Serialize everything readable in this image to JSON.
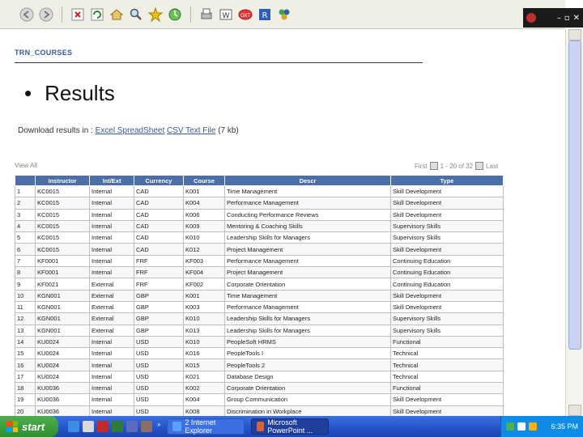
{
  "browser": {
    "window_controls": {
      "minimize": "–",
      "maximize": "▫",
      "close": "✕"
    },
    "toolbar_icons": [
      "back-icon",
      "forward-icon",
      "stop-icon",
      "refresh-icon",
      "home-icon",
      "search-icon",
      "favorites-icon",
      "history-icon",
      "print-icon",
      "edit-icon",
      "messenger-icon",
      "research-icon",
      "extensions-icon"
    ]
  },
  "page": {
    "heading": "TRN_COURSES",
    "bullet_title": "Results",
    "download_prefix": "Download results in :",
    "download_excel": "Excel SpreadSheet",
    "download_csv": "CSV Text File",
    "download_size": "(7 kb)",
    "view_all": "View All",
    "pager_first": "First",
    "pager_range": "1 - 20 of 32",
    "pager_last": "Last"
  },
  "table": {
    "headers": [
      "",
      "Instructor",
      "Int/Ext",
      "Currency",
      "Course",
      "Descr",
      "Type"
    ],
    "rows": [
      [
        "1",
        "KC0015",
        "Internal",
        "CAD",
        "K001",
        "Time Management",
        "Skill Development"
      ],
      [
        "2",
        "KC0015",
        "Internal",
        "CAD",
        "K004",
        "Performance Management",
        "Skill Development"
      ],
      [
        "3",
        "KC0015",
        "Internal",
        "CAD",
        "K006",
        "Conducting Performance Reviews",
        "Skill Development"
      ],
      [
        "4",
        "KC0015",
        "Internal",
        "CAD",
        "K009",
        "Mentoring & Coaching Skills",
        "Supervisory Skills"
      ],
      [
        "5",
        "KC0015",
        "Internal",
        "CAD",
        "K010",
        "Leadership Skills for Managers",
        "Supervisory Skills"
      ],
      [
        "6",
        "KC0015",
        "Internal",
        "CAD",
        "K012",
        "Project Management",
        "Skill Development"
      ],
      [
        "7",
        "KF0001",
        "Internal",
        "FRF",
        "KF003",
        "Performance Management",
        "Continuing Education"
      ],
      [
        "8",
        "KF0001",
        "Internal",
        "FRF",
        "KF004",
        "Project Management",
        "Continuing Education"
      ],
      [
        "9",
        "KF0021",
        "External",
        "FRF",
        "KF002",
        "Corporate Orientation",
        "Continuing Education"
      ],
      [
        "10",
        "KGN001",
        "External",
        "GBP",
        "K001",
        "Time Management",
        "Skill Development"
      ],
      [
        "11",
        "KGN001",
        "External",
        "GBP",
        "K003",
        "Performance Management",
        "Skill Development"
      ],
      [
        "12",
        "KGN001",
        "External",
        "GBP",
        "K010",
        "Leadership Skills for Managers",
        "Supervisory Skills"
      ],
      [
        "13",
        "KGN001",
        "External",
        "GBP",
        "K013",
        "Leadership Skills for Managers",
        "Supervisory Skills"
      ],
      [
        "14",
        "KU0024",
        "Internal",
        "USD",
        "K010",
        "PeopleSoft HRMS",
        "Functional"
      ],
      [
        "15",
        "KU0024",
        "Internal",
        "USD",
        "K016",
        "PeopleTools I",
        "Technical"
      ],
      [
        "16",
        "KU0024",
        "Internal",
        "USD",
        "K015",
        "PeopleTools 2",
        "Technical"
      ],
      [
        "17",
        "KU0024",
        "Internal",
        "USD",
        "K021",
        "Database Design",
        "Technical"
      ],
      [
        "18",
        "KU0036",
        "Internal",
        "USD",
        "K002",
        "Corporate Orientation",
        "Functional"
      ],
      [
        "19",
        "KU0036",
        "Internal",
        "USD",
        "K004",
        "Group Communication",
        "Skill Development"
      ],
      [
        "20",
        "KU0036",
        "Internal",
        "USD",
        "K008",
        "Discrimination in Workplace",
        "Skill Development"
      ]
    ]
  },
  "taskbar": {
    "start_label": "start",
    "ql_chevron": "»",
    "tasks": [
      {
        "label": "2 Internet Explorer",
        "icon": "internet-explorer-icon"
      },
      {
        "label": "Microsoft PowerPoint ...",
        "icon": "powerpoint-icon"
      }
    ],
    "clock": "6:35 PM"
  }
}
